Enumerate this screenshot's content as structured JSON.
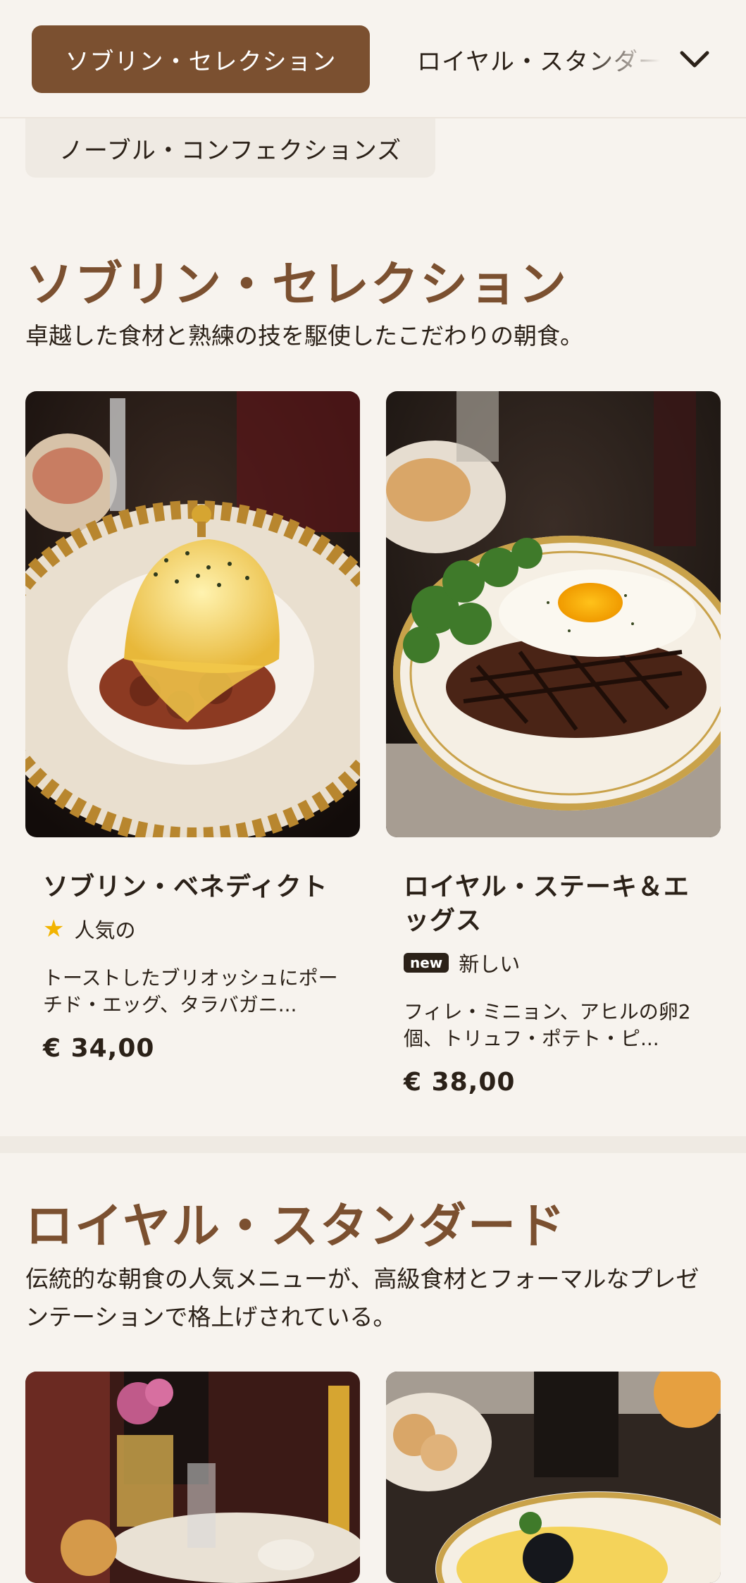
{
  "tabs": {
    "active": "ソブリン・セレクション",
    "next": "ロイヤル・スタンダード",
    "partial": "ノーブル・コンフェクションズ"
  },
  "sections": [
    {
      "title": "ソブリン・セレクション",
      "description": "卓越した食材と熟練の技を駆使したこだわりの朝食。",
      "items": [
        {
          "name": "ソブリン・ベネディクト",
          "badge_icon": "star-icon",
          "badge": "人気の",
          "description": "トーストしたブリオッシュにポーチド・エッグ、タラバガニ...",
          "price": "€ 34,00"
        },
        {
          "name": "ロイヤル・ステーキ＆エッグス",
          "badge_icon": "new-badge",
          "badge_pill": "new",
          "badge": "新しい",
          "description": "フィレ・ミニョン、アヒルの卵2個、トリュフ・ポテト・ピ...",
          "price": "€ 38,00"
        }
      ]
    },
    {
      "title": "ロイヤル・スタンダード",
      "description": "伝統的な朝食の人気メニューが、高級食材とフォーマルなプレゼンテーションで格上げされている。"
    }
  ],
  "colors": {
    "accent": "#7b5030",
    "background": "#f7f3ee",
    "star": "#f2b400"
  }
}
